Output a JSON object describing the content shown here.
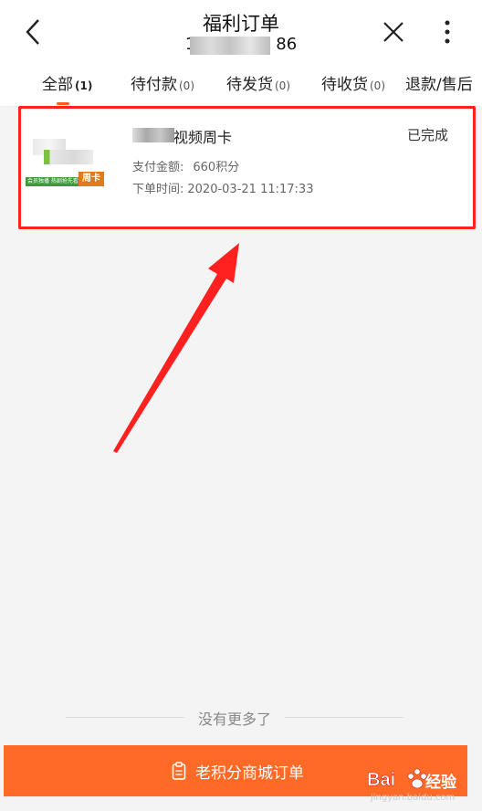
{
  "header": {
    "title": "福利订单",
    "subtitle_tail": "86",
    "back_icon": "chevron-left-icon",
    "close_icon": "close-icon",
    "more_icon": "more-vertical-icon"
  },
  "tabs": [
    {
      "label": "全部",
      "count": "(1)",
      "active": true
    },
    {
      "label": "待付款",
      "count": "(0)"
    },
    {
      "label": "待发货",
      "count": "(0)"
    },
    {
      "label": "待收货",
      "count": "(0)"
    },
    {
      "label": "退款/售后",
      "count": ""
    }
  ],
  "order": {
    "name": "视频周卡",
    "status": "已完成",
    "pay_label": "支付金额:",
    "pay_value": "660积分",
    "time_label": "下单时间:",
    "time_value": "2020-03-21 11:17:33",
    "thumb_badge": "周卡",
    "thumb_stripe": "会员独播 热剧抢先看"
  },
  "footer": {
    "no_more": "没有更多了",
    "button_label": "老积分商城订单",
    "button_icon": "clipboard-icon"
  },
  "watermark": {
    "text": "Bai 经验",
    "url": "jingyan.baidu.com"
  },
  "colors": {
    "accent": "#ff6a26",
    "highlight": "#ff2020"
  }
}
